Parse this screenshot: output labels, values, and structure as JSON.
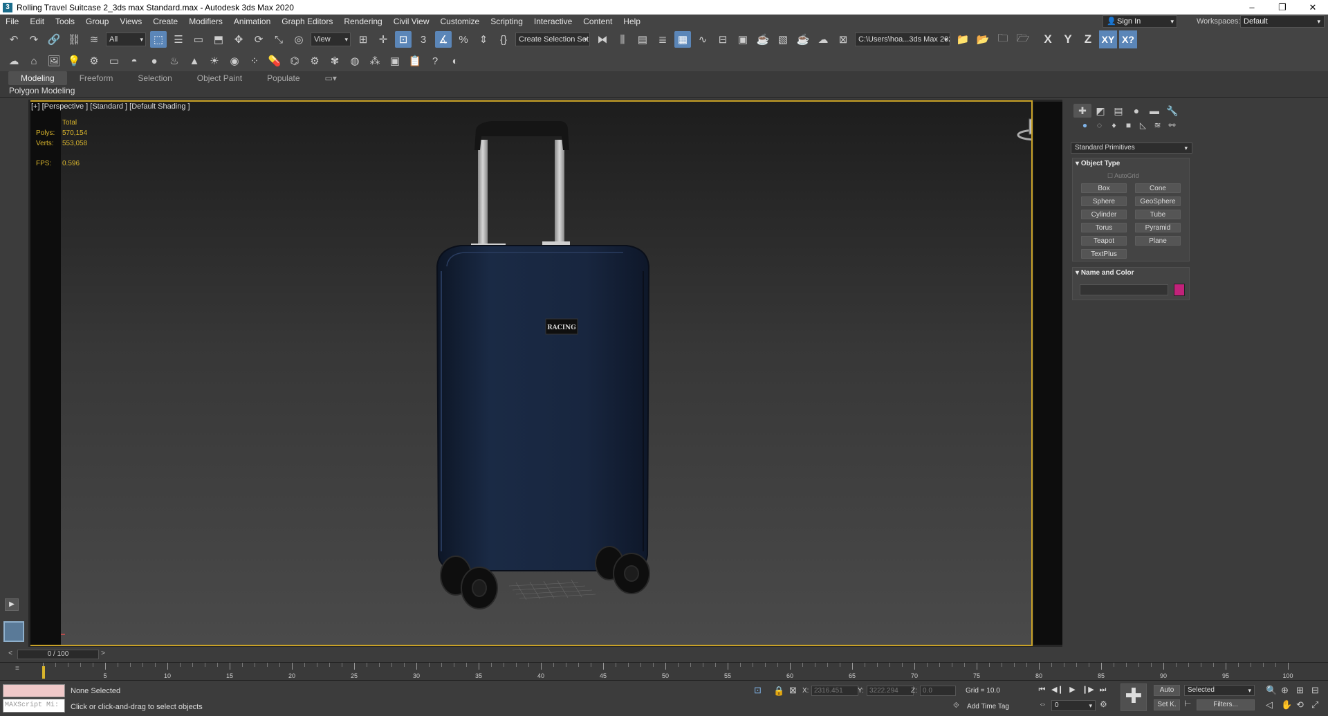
{
  "window": {
    "title": "Rolling Travel Suitcase 2_3ds max Standard.max - Autodesk 3ds Max 2020",
    "app_icon": "3",
    "controls": [
      "–",
      "❐",
      "✕"
    ]
  },
  "menu": [
    "File",
    "Edit",
    "Tools",
    "Group",
    "Views",
    "Create",
    "Modifiers",
    "Animation",
    "Graph Editors",
    "Rendering",
    "Civil View",
    "Customize",
    "Scripting",
    "Interactive",
    "Content",
    "Help"
  ],
  "account": {
    "sign_in": "Sign In",
    "workspaces_label": "Workspaces:",
    "workspace": "Default"
  },
  "toolbar1": {
    "selection_filter": "All",
    "ref_coord": "View",
    "selection_set": "Create Selection Set",
    "project_path": "C:\\Users\\hoa...3ds Max 2020",
    "axis": [
      "X",
      "Y",
      "Z",
      "XY",
      "X?"
    ]
  },
  "ribbon": {
    "tabs": [
      "Modeling",
      "Freeform",
      "Selection",
      "Object Paint",
      "Populate"
    ],
    "sub": "Polygon Modeling"
  },
  "viewport": {
    "label": "[+] [Perspective ] [Standard ] [Default Shading ]",
    "stats_header": "Total",
    "polys_label": "Polys:",
    "polys": "570,154",
    "verts_label": "Verts:",
    "verts": "553,058",
    "fps_label": "FPS:",
    "fps": "0.596",
    "badge_text": "RACING",
    "body_color": "#1b2c48"
  },
  "command_panel": {
    "category": "Standard Primitives",
    "object_type": "Object Type",
    "autogrid": "AutoGrid",
    "primitives": [
      "Box",
      "Cone",
      "Sphere",
      "GeoSphere",
      "Cylinder",
      "Tube",
      "Torus",
      "Pyramid",
      "Teapot",
      "Plane",
      "TextPlus"
    ],
    "name_and_color": "Name and Color",
    "swatch_color": "#c2227a"
  },
  "timeline": {
    "frame": "0 / 100",
    "ticks": [
      "5",
      "10",
      "15",
      "20",
      "25",
      "30",
      "35",
      "40",
      "45",
      "50",
      "55",
      "60",
      "65",
      "70",
      "75",
      "80",
      "85",
      "90",
      "95",
      "100"
    ]
  },
  "status": {
    "maxscript": "MAXScript Mi:",
    "selection": "None Selected",
    "hint": "Click or click-and-drag to select objects",
    "x_label": "X:",
    "x": "2316.451",
    "y_label": "Y:",
    "y": "3222.294",
    "z_label": "Z:",
    "z": "0.0",
    "grid": "Grid = 10.0",
    "add_time_tag": "Add Time Tag",
    "auto": "Auto",
    "set_key": "Set K.",
    "key_filter": "Selected",
    "filters": "Filters...",
    "current_frame": "0"
  }
}
